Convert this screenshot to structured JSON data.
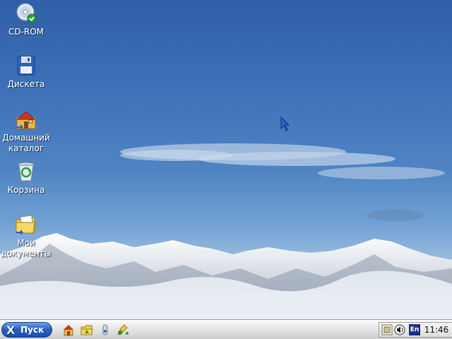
{
  "desktop": {
    "icons": [
      {
        "label": "CD-ROM",
        "icon": "cd-rom-icon"
      },
      {
        "label": "Дискета",
        "icon": "floppy-disk-icon"
      },
      {
        "label": "Домашний каталог",
        "icon": "home-folder-icon"
      },
      {
        "label": "Корзина",
        "icon": "trash-icon"
      },
      {
        "label": "Мои документы",
        "icon": "documents-folder-icon"
      }
    ]
  },
  "taskbar": {
    "start_label": "Пуск",
    "quick_launch": [
      "home-icon",
      "folder-icon",
      "security-icon",
      "cleanup-icon"
    ],
    "tray": {
      "language": "En",
      "clock": "11:46"
    }
  },
  "colors": {
    "sky_top": "#2f5fa7",
    "start_button": "#2a62c4",
    "taskbar": "#dcdcdc"
  }
}
